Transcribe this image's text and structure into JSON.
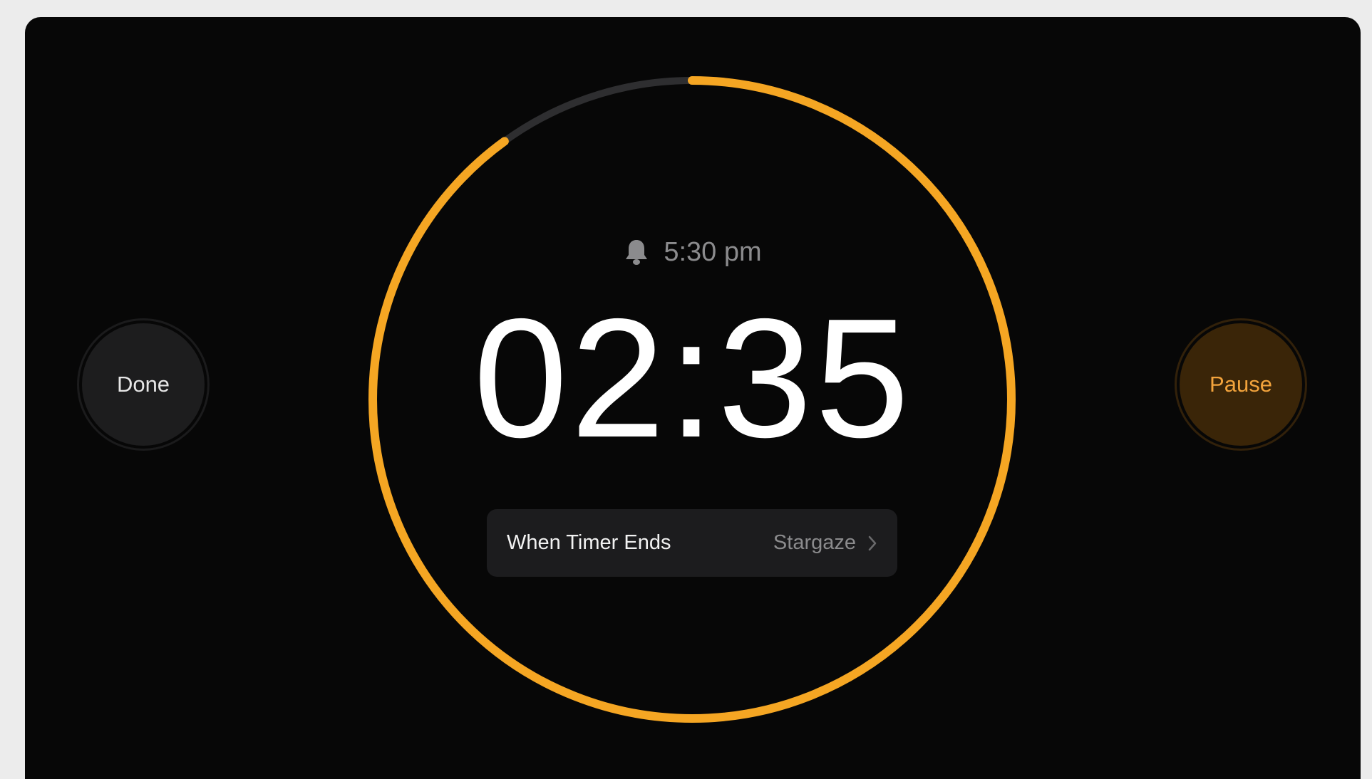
{
  "timer": {
    "remaining": "02:35",
    "progress_remaining_fraction": 0.9,
    "accent_color": "#f5a623",
    "track_color": "#2e2e30"
  },
  "alarm": {
    "icon": "bell-icon",
    "end_time": "5:30 pm"
  },
  "buttons": {
    "done_label": "Done",
    "pause_label": "Pause"
  },
  "when_timer_ends": {
    "label": "When Timer Ends",
    "value": "Stargaze",
    "icon": "chevron-right-icon"
  }
}
